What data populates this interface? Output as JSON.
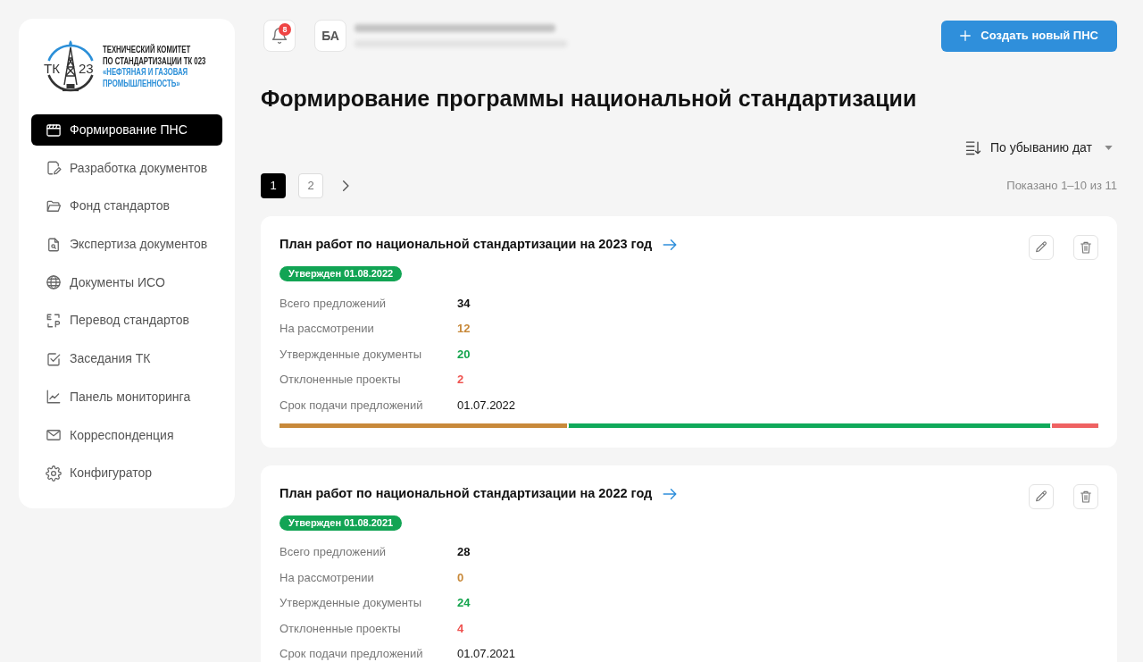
{
  "sidebar": {
    "logo": {
      "emblem": [
        "ТК",
        "23"
      ],
      "title_lines": [
        "ТЕХНИЧЕСКИЙ КОМИТЕТ",
        "ПО СТАНДАРТИЗАЦИИ ТК 023"
      ],
      "name_lines": [
        "«НЕФТЯНАЯ И ГАЗОВАЯ",
        "ПРОМЫШЛЕННОСТЬ»"
      ]
    },
    "nav": [
      {
        "label": "Формирование ПНС",
        "selected": true
      },
      {
        "label": "Разработка документов",
        "selected": false
      },
      {
        "label": "Фонд стандартов",
        "selected": false
      },
      {
        "label": "Экспертиза документов",
        "selected": false
      },
      {
        "label": "Документы ИСО",
        "selected": false
      },
      {
        "label": "Перевод стандартов",
        "selected": false
      },
      {
        "label": "Заседания ТК",
        "selected": false
      },
      {
        "label": "Панель мониторинга",
        "selected": false
      },
      {
        "label": "Корреспонденция",
        "selected": false
      },
      {
        "label": "Конфигуратор",
        "selected": false
      }
    ]
  },
  "header": {
    "notifications": {
      "count": "8"
    },
    "avatar": {
      "initials": "БА"
    },
    "create_button": {
      "label": "Создать новый ПНС"
    }
  },
  "page_title": "Формирование программы национальной стандартизации",
  "sort": {
    "label": "По убыванию дат"
  },
  "pagination": {
    "pages": [
      {
        "label": "1",
        "selected": true
      },
      {
        "label": "2",
        "selected": false
      }
    ],
    "summary": "Показано 1–10 из 11"
  },
  "plans": [
    {
      "title": "План работ по национальной стандартизации на 2023 год",
      "status": {
        "label": "Утвержден 01.08.2022",
        "kind": "approved"
      },
      "stats": [
        {
          "label": "Всего предложений",
          "value": "34",
          "kind": "total"
        },
        {
          "label": "На рассмотрении",
          "value": "12",
          "kind": "pending"
        },
        {
          "label": "Утвержденные документы",
          "value": "20",
          "kind": "approved"
        },
        {
          "label": "Отклоненные проекты",
          "value": "2",
          "kind": "rejected"
        },
        {
          "label": "Срок подачи предложений",
          "value": "01.07.2022",
          "kind": "date"
        }
      ],
      "progress": {
        "kind": "approved",
        "fills": [
          {
            "kind": "pending",
            "level": 0.353
          },
          {
            "kind": "rejected",
            "level": 0.059
          }
        ]
      }
    },
    {
      "title": "План работ по национальной стандартизации на 2022 год",
      "status": {
        "label": "Утвержден 01.08.2021",
        "kind": "approved"
      },
      "stats": [
        {
          "label": "Всего предложений",
          "value": "28",
          "kind": "total"
        },
        {
          "label": "На рассмотрении",
          "value": "0",
          "kind": "pending"
        },
        {
          "label": "Утвержденные документы",
          "value": "24",
          "kind": "approved"
        },
        {
          "label": "Отклоненные проекты",
          "value": "4",
          "kind": "rejected"
        },
        {
          "label": "Срок подачи предложений",
          "value": "01.07.2021",
          "kind": "date"
        }
      ]
    }
  ]
}
